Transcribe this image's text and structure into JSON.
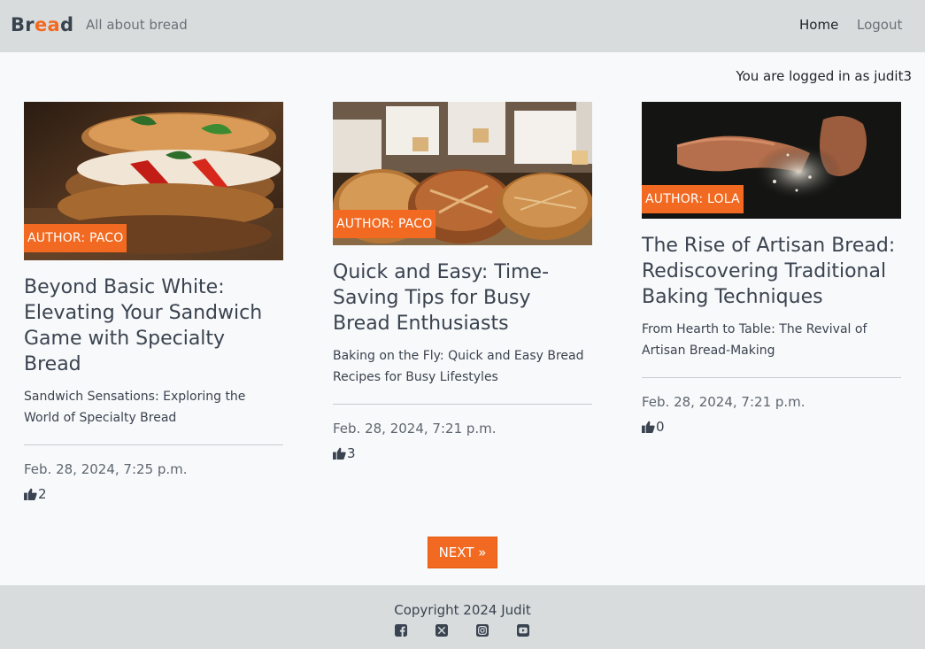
{
  "navbar": {
    "brand_part1": "Br",
    "brand_part2": "ea",
    "brand_part3": "d",
    "tagline": "All about bread",
    "home_label": "Home",
    "logout_label": "Logout"
  },
  "status": {
    "logged_in_text": "You are logged in as judit3"
  },
  "posts": [
    {
      "author_badge": "AUTHOR: PACO",
      "title": "Beyond Basic White: Elevating Your Sandwich Game with Specialty Bread",
      "excerpt": "Sandwich Sensations: Exploring the World of Specialty Bread",
      "date": "Feb. 28, 2024, 7:25 p.m.",
      "likes": "2",
      "image_icon": "sandwich-photo"
    },
    {
      "author_badge": "AUTHOR: PACO",
      "title": "Quick and Easy: Time-Saving Tips for Busy Bread Enthusiasts",
      "excerpt": "Baking on the Fly: Quick and Easy Bread Recipes for Busy Lifestyles",
      "date": "Feb. 28, 2024, 7:21 p.m.",
      "likes": "3",
      "image_icon": "bread-loaves-photo"
    },
    {
      "author_badge": "AUTHOR: LOLA",
      "title": "The Rise of Artisan Bread: Rediscovering Traditional Baking Techniques",
      "excerpt": "From Hearth to Table: The Revival of Artisan Bread-Making",
      "date": "Feb. 28, 2024, 7:21 p.m.",
      "likes": "0",
      "image_icon": "flour-hands-photo"
    }
  ],
  "pagination": {
    "next_label": "NEXT »"
  },
  "footer": {
    "copyright": "Copyright 2024 Judit",
    "social_icons": [
      "facebook-icon",
      "x-icon",
      "instagram-icon",
      "youtube-icon"
    ]
  },
  "colors": {
    "accent": "#f26a21",
    "navbar_bg": "#d8dcdd",
    "page_bg": "#f8f9fa",
    "text": "#3a4350"
  }
}
